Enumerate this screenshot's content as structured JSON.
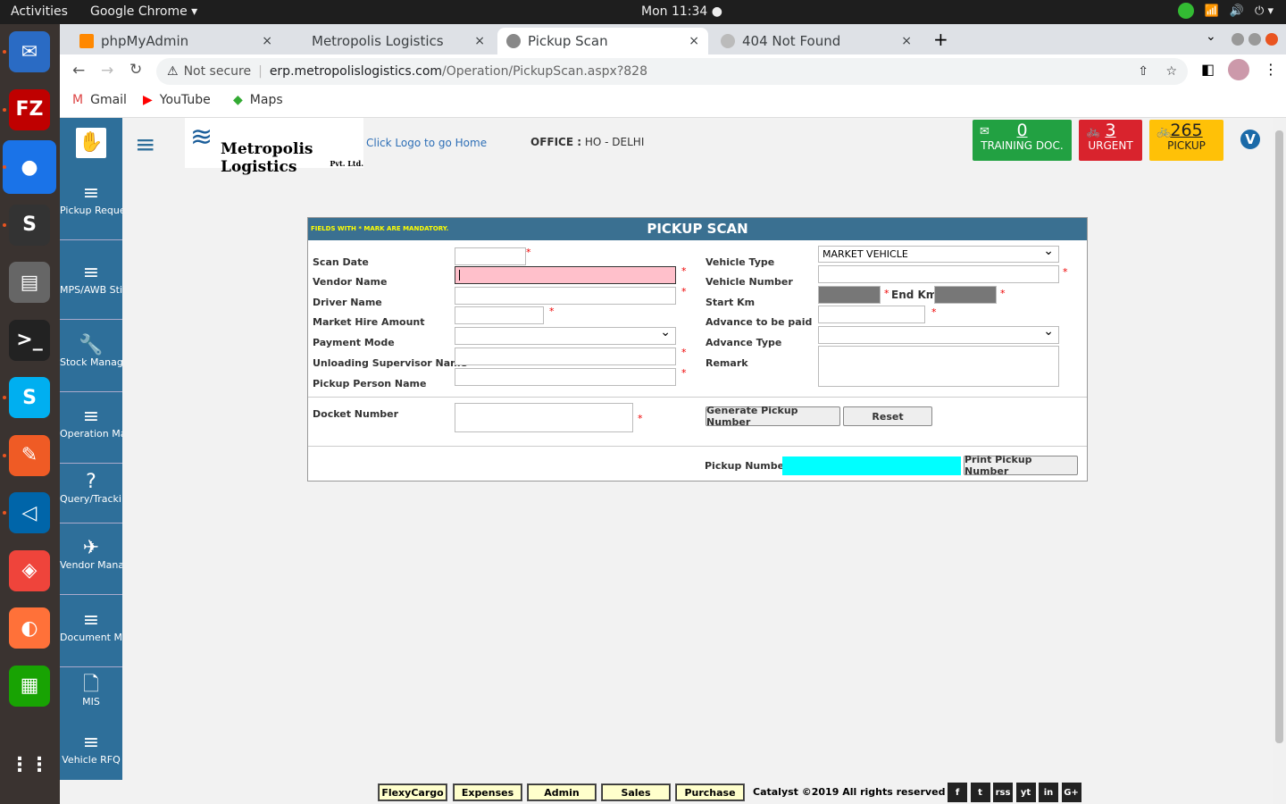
{
  "topbar": {
    "activities": "Activities",
    "app": "Google Chrome ▾",
    "clock": "Mon 11:34 ●"
  },
  "dock": [
    {
      "name": "thunderbird-icon",
      "g": "✉",
      "c": "#2a6bc4"
    },
    {
      "name": "filezilla-icon",
      "g": "FZ",
      "c": "#bf0000"
    },
    {
      "name": "chrome-icon",
      "g": "●",
      "c": "#1a73e8"
    },
    {
      "name": "sublime-icon",
      "g": "S",
      "c": "#333"
    },
    {
      "name": "files-icon",
      "g": "▤",
      "c": "#666"
    },
    {
      "name": "terminal-icon",
      "g": ">_",
      "c": "#222"
    },
    {
      "name": "skype-icon",
      "g": "S",
      "c": "#00aff0"
    },
    {
      "name": "postman-icon",
      "g": "✎",
      "c": "#ef5b25"
    },
    {
      "name": "vscode-icon",
      "g": "◁",
      "c": "#0065a9"
    },
    {
      "name": "anydesk-icon",
      "g": "◈",
      "c": "#ef443b"
    },
    {
      "name": "firefox-icon",
      "g": "◐",
      "c": "#ff7139"
    },
    {
      "name": "calc-icon",
      "g": "▦",
      "c": "#18a303"
    },
    {
      "name": "apps-grid-icon",
      "g": "⋮⋮",
      "c": "transparent"
    }
  ],
  "tabs": [
    {
      "title": "phpMyAdmin",
      "x": "×"
    },
    {
      "title": "Metropolis Logistics",
      "x": "×"
    },
    {
      "title": "Pickup Scan",
      "x": "×"
    },
    {
      "title": "404 Not Found",
      "x": "×"
    }
  ],
  "address": {
    "security": "Not secure",
    "url_host": "erp.metropolislogistics.com",
    "url_path": "/Operation/PickupScan.aspx?828"
  },
  "bookmarks": [
    "Gmail",
    "YouTube",
    "Maps"
  ],
  "header": {
    "logo_title": "Metropolis Logistics",
    "logo_sub": "Pvt. Ltd.",
    "home_hint": "Click Logo to go Home",
    "office_label": "OFFICE :",
    "office_value": " HO - DELHI",
    "user_initial": "V"
  },
  "badges": [
    {
      "count": "0",
      "label": "TRAINING DOC.",
      "color": "#22a142"
    },
    {
      "count": "3",
      "label": "URGENT",
      "color": "#d9232d"
    },
    {
      "count": "265",
      "label": "PICKUP",
      "color": "#ffc107"
    }
  ],
  "sidebar": [
    {
      "label": "Pickup Request",
      "icon": "≡"
    },
    {
      "label": "MPS/AWB Sticker",
      "icon": "≡"
    },
    {
      "label": "Stock Management",
      "icon": "🔧"
    },
    {
      "label": "Operation Management",
      "icon": "≡"
    },
    {
      "label": "Query/Tracking",
      "icon": "?"
    },
    {
      "label": "Vendor Management",
      "icon": "✈"
    },
    {
      "label": "Document Movement",
      "icon": "≡"
    },
    {
      "label": "MIS",
      "icon": "🗋"
    },
    {
      "label": "Vehicle RFQ",
      "icon": "≡"
    }
  ],
  "form": {
    "title": "PICKUP SCAN",
    "note": "FIELDS WITH * MARK ARE MANDATORY.",
    "left": [
      "Scan Date",
      "Vendor Name",
      "Driver Name",
      "Market Hire Amount",
      "Payment Mode",
      "Unloading Supervisor Name",
      "Pickup Person Name"
    ],
    "right": [
      "Vehicle Type",
      "Vehicle Number",
      "Start Km",
      "Advance to be paid",
      "Advance Type",
      "Remark"
    ],
    "vehicle_type_value": "MARKET VEHICLE",
    "end_km": "End Km",
    "docket_label": "Docket Number",
    "generate_btn": "Generate Pickup Number",
    "reset_btn": "Reset",
    "pickup_number_label": "Pickup Number",
    "print_btn": "Print Pickup Number"
  },
  "footer": {
    "buttons": [
      "FlexyCargo",
      "Expenses",
      "Admin",
      "Sales",
      "Purchase"
    ],
    "copyright": "Catalyst  ©2019 All rights reserved",
    "social": [
      "f",
      "t",
      "rss",
      "yt",
      "in",
      "G+"
    ]
  }
}
